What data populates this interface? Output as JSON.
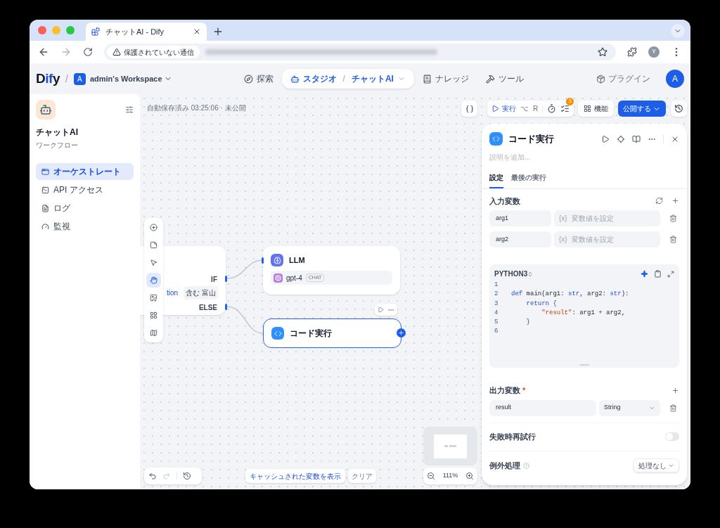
{
  "browser": {
    "tab_title": "チャットAI - Dify",
    "security_label": "保護されていない通信",
    "profile": "Y"
  },
  "header": {
    "separator": "/",
    "logo": [
      {
        "text": "D",
        "accent": false
      },
      {
        "text": "if",
        "accent": true
      },
      {
        "text": "y",
        "accent": false
      }
    ],
    "workspace_initial": "A",
    "workspace": "admin's Workspace",
    "nav": [
      {
        "kind": "explore",
        "label": "探索",
        "selected": false
      },
      {
        "kind": "studio",
        "label": "スタジオ",
        "sep": "/",
        "sub": "チャットAI",
        "selected": true
      },
      {
        "kind": "knowledge",
        "label": "ナレッジ",
        "selected": false
      },
      {
        "kind": "tools",
        "label": "ツール",
        "selected": false
      }
    ],
    "plugins": "プラグイン",
    "avatar": "A"
  },
  "sidebar": {
    "app_name": "チャットAI",
    "app_type": "ワークフロー",
    "items": [
      {
        "kind": "orchestrate",
        "label": "オーケストレート",
        "selected": true
      },
      {
        "kind": "api",
        "label": "API アクセス",
        "selected": false
      },
      {
        "kind": "logs",
        "label": "ログ",
        "selected": false
      },
      {
        "kind": "monitor",
        "label": "監視",
        "selected": false
      }
    ]
  },
  "canvas": {
    "autosave": "自動保存済み 03:25:06 · 未公開",
    "toolbar": {
      "run": "実行",
      "keys": [
        "⌥",
        "R"
      ],
      "checklist_count": "3",
      "features": "機能",
      "publish": "公開する"
    },
    "tools": [
      {
        "kind": "add",
        "selected": false
      },
      {
        "kind": "note",
        "selected": false
      },
      {
        "kind": "pointer",
        "selected": false
      },
      {
        "kind": "hand",
        "selected": true
      },
      {
        "kind": "export",
        "selected": false
      },
      {
        "kind": "organize",
        "selected": false
      },
      {
        "kind": "minimap",
        "selected": false
      }
    ],
    "ifelse_node": {
      "if": "IF",
      "condition_var": "tion",
      "condition": "含む 富山",
      "else": "ELSE"
    },
    "llm_node": {
      "title": "LLM",
      "model": "gpt-4",
      "mode": "CHAT"
    },
    "code_node": {
      "title": "コード実行",
      "selected": true
    },
    "show_cache": "キャッシュされた変数を表示",
    "clear": "クリア",
    "zoom": "111%"
  },
  "panel": {
    "title": "コード実行",
    "description_placeholder": "説明を追加...",
    "tabs": [
      {
        "label": "設定",
        "selected": true
      },
      {
        "label": "最後の実行",
        "selected": false
      }
    ],
    "inputs_label": "入力変数",
    "inputs": [
      {
        "name": "arg1",
        "prefix": "{x}",
        "placeholder": "変数値を設定"
      },
      {
        "name": "arg2",
        "prefix": "{x}",
        "placeholder": "変数値を設定"
      }
    ],
    "language": "PYTHON3",
    "code": [
      {
        "number": "1"
      },
      {
        "number": "2",
        "tokens": [
          {
            "kind": "keyword",
            "text": "def"
          },
          {
            "kind": "plain",
            "text": " main(arg1: "
          },
          {
            "kind": "type",
            "text": "str"
          },
          {
            "kind": "plain",
            "text": ", arg2: "
          },
          {
            "kind": "type",
            "text": "str"
          },
          {
            "kind": "plain",
            "text": "):"
          }
        ]
      },
      {
        "number": "3",
        "tokens": [
          {
            "kind": "keyword",
            "text": "    return"
          },
          {
            "kind": "keyword",
            "text": " {"
          }
        ]
      },
      {
        "number": "4",
        "tokens": [
          {
            "kind": "string",
            "text": "        \"result\""
          },
          {
            "kind": "plain",
            "text": ": arg1 + arg2,"
          }
        ]
      },
      {
        "number": "5",
        "tokens": [
          {
            "kind": "keyword",
            "text": "    }"
          }
        ]
      },
      {
        "number": "6"
      }
    ],
    "outputs_label": "出力変数",
    "required_mark": "*",
    "outputs": [
      {
        "name": "result",
        "type": "String"
      }
    ],
    "retry": {
      "label": "失敗時再試行",
      "on": false
    },
    "error_handling": {
      "label": "例外処理",
      "value": "処理なし"
    }
  }
}
